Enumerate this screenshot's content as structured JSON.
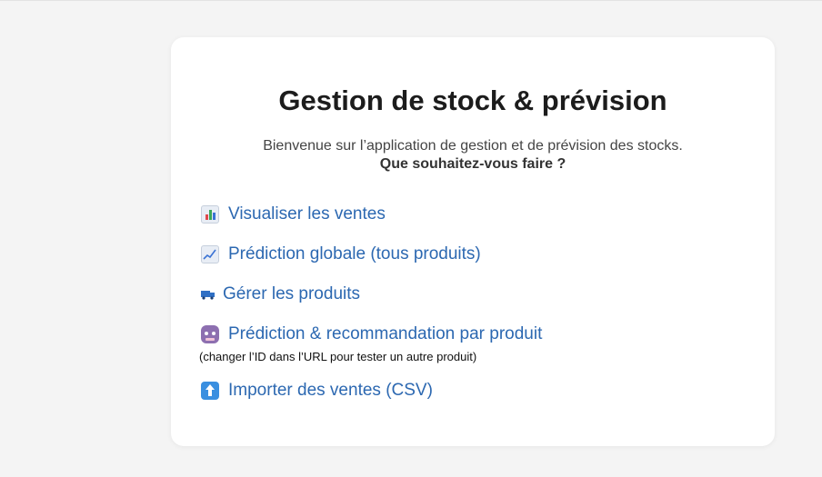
{
  "page": {
    "title": "Gestion de stock & prévision",
    "welcome_text": "Bienvenue sur l’application de gestion et de prévision des stocks.",
    "question_text": "Que souhaitez-vous faire ?"
  },
  "menu": {
    "items": [
      {
        "label": "Visualiser les ventes",
        "icon": "bar-chart-icon"
      },
      {
        "label": "Prédiction globale (tous produits)",
        "icon": "trend-chart-icon"
      },
      {
        "label": "Gérer les produits",
        "icon": "truck-icon"
      },
      {
        "label": "Prédiction & recommandation par produit",
        "icon": "robot-icon",
        "hint": "(changer l’ID dans l’URL pour tester un autre produit)"
      },
      {
        "label": "Importer des ventes (CSV)",
        "icon": "up-arrow-icon"
      }
    ]
  },
  "colors": {
    "background": "#f4f4f4",
    "card": "#ffffff",
    "link": "#2c68b1",
    "title": "#1c1c1c"
  }
}
